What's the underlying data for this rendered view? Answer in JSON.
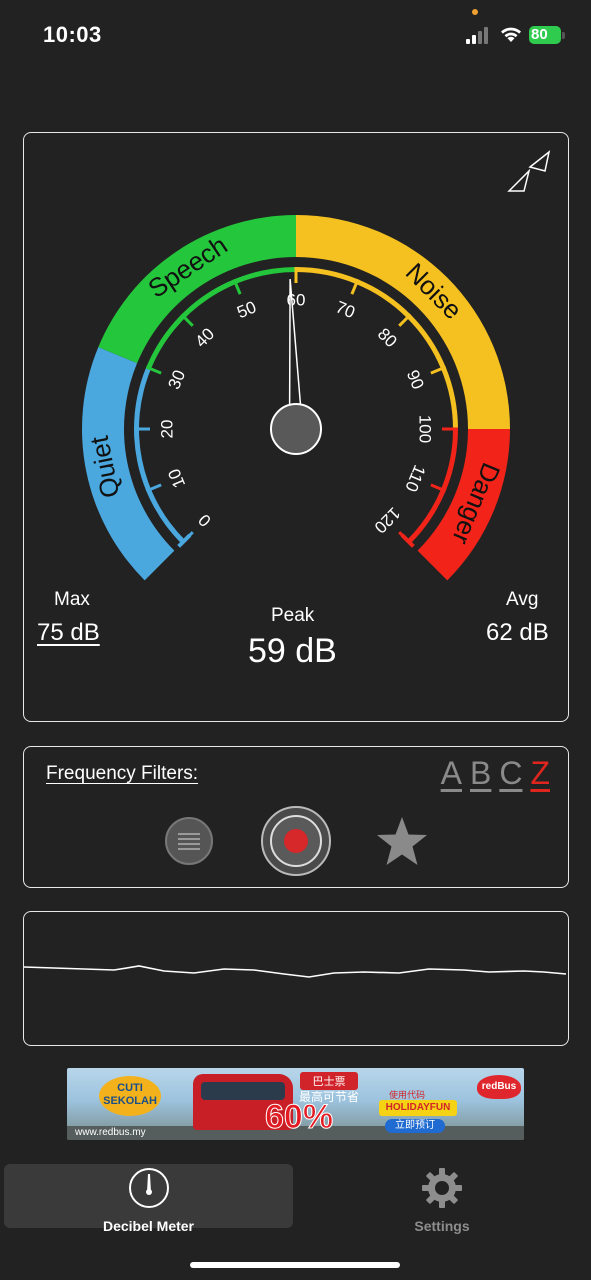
{
  "status_bar": {
    "time": "10:03",
    "battery": "80"
  },
  "gauge": {
    "zones": [
      "Quiet",
      "Speech",
      "Noise",
      "Danger"
    ],
    "zone_colors": {
      "quiet": "#4aa8df",
      "speech": "#24c63c",
      "noise": "#f5c120",
      "danger": "#f2241a"
    },
    "scale_labels": [
      "0",
      "10",
      "20",
      "30",
      "40",
      "50",
      "60",
      "70",
      "80",
      "90",
      "100",
      "110",
      "120"
    ],
    "needle_value": 59,
    "max_label": "Max",
    "max_value": "75 dB",
    "peak_label": "Peak",
    "peak_value": "59 dB",
    "avg_label": "Avg",
    "avg_value": "62 dB"
  },
  "filters": {
    "title": "Frequency Filters:",
    "options": [
      "A",
      "B",
      "C",
      "Z"
    ],
    "selected": "Z"
  },
  "ad": {
    "badge": "CUTI SEKOLAH",
    "url": "www.redbus.my",
    "headline": "巴士票",
    "subline": "最高可节省",
    "percent": "60%",
    "code_label": "使用代码",
    "code": "HOLIDAYFUN",
    "cta": "立即预订",
    "brand": "redBus"
  },
  "tabs": [
    {
      "label": "Decibel Meter",
      "icon": "gauge-icon",
      "active": true
    },
    {
      "label": "Settings",
      "icon": "gear-icon",
      "active": false
    }
  ]
}
